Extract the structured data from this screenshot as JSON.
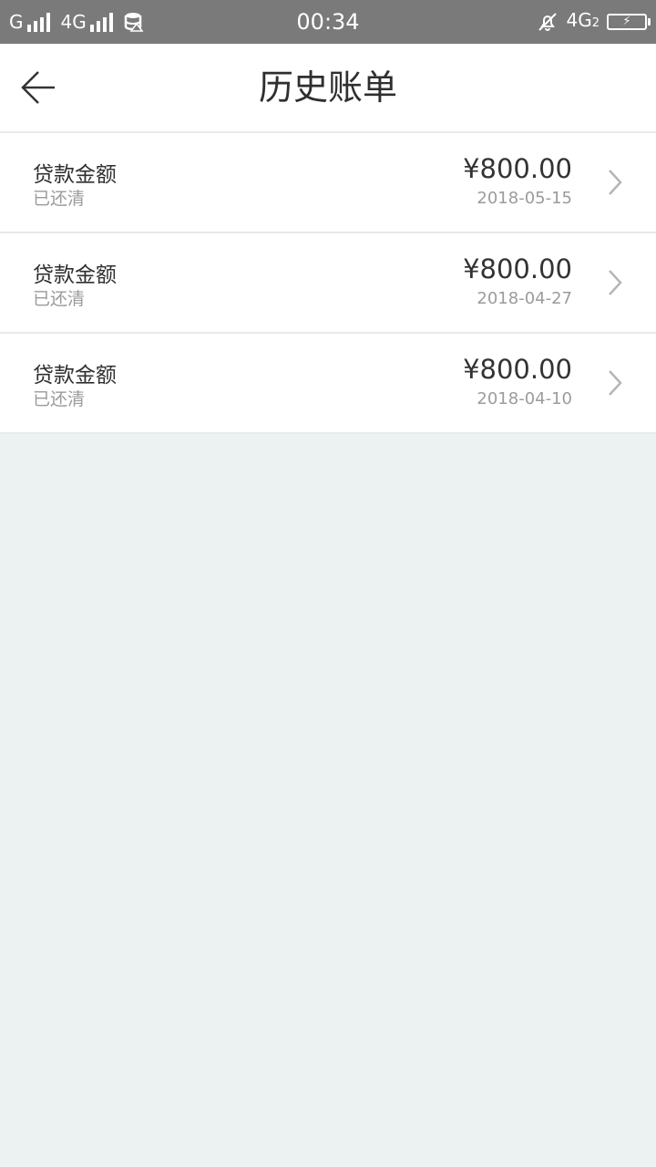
{
  "status_bar": {
    "carrier1": "G",
    "carrier2": "4G",
    "time": "00:34",
    "network_right": "4G",
    "network_right_sub": "2",
    "icons": [
      "signal-icon",
      "database-icon",
      "mute-icon",
      "battery-charging-icon"
    ]
  },
  "header": {
    "title": "历史账单",
    "back_icon": "back-arrow-icon"
  },
  "bills": [
    {
      "label": "贷款金额",
      "status": "已还清",
      "amount": "¥800.00",
      "date": "2018-05-15"
    },
    {
      "label": "贷款金额",
      "status": "已还清",
      "amount": "¥800.00",
      "date": "2018-04-27"
    },
    {
      "label": "贷款金额",
      "status": "已还清",
      "amount": "¥800.00",
      "date": "2018-04-10"
    }
  ],
  "colors": {
    "status_bar_bg": "#7a7a7a",
    "page_bg": "#ecf2f2",
    "card_bg": "#ffffff",
    "primary_text": "#2f2f2f",
    "secondary_text": "#9b9b9b",
    "chevron": "#b5b5b5"
  }
}
